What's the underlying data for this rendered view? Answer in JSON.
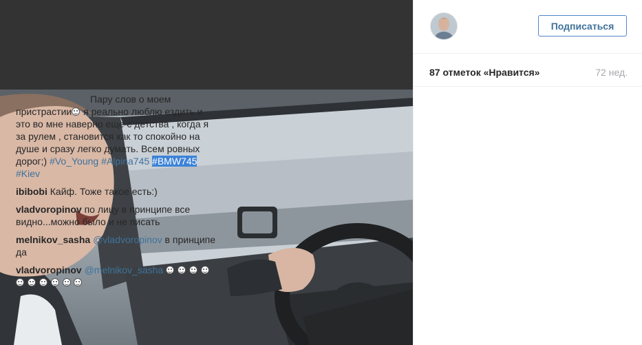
{
  "post": {
    "follow_label": "Подписаться",
    "likes_text": "87 отметок «Нравится»",
    "time_ago": "72 нед.",
    "avatar_icon": "user-avatar-photo",
    "caption": {
      "part1": "Пару слов о моем пристрастии",
      "part2": " я реально люблю ездить и это во мне наверно еще с детства , когда я за рулем , становится как то спокойно на душе и сразу легко думать. Всем ровных дорог;) ",
      "tags": [
        "#Vo_Young",
        "#Alpina745",
        "#BMW745",
        "#Kiev"
      ],
      "highlighted_tag": "#BMW745"
    },
    "comments": [
      {
        "user": "ibibobi",
        "text": "Кайф. Тоже такое есть:)"
      },
      {
        "user": "vladvoropinov",
        "text": "по лицу в принципе все видно...можно было и не писать"
      },
      {
        "user": "melnikov_sasha",
        "mention": "@vladvoropinov",
        "text": " в принципе да"
      },
      {
        "user": "vladvoropinov",
        "mention": "@melnikov_sasha",
        "text": "",
        "emoji_count": 10
      }
    ]
  },
  "colors": {
    "link": "#3f729b",
    "button_border": "#4f86c9",
    "highlight": "#3d82d8",
    "muted": "#a5a7aa",
    "media_bg": "#333333"
  }
}
